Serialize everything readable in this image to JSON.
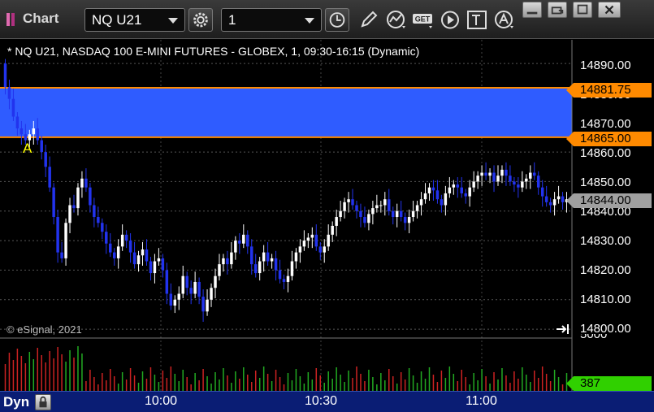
{
  "window": {
    "title": "Chart",
    "symbol": "NQ U21",
    "interval": "1",
    "get_label": "GET"
  },
  "chart": {
    "caption": "* NQ U21, NASDAQ 100 E-MINI FUTURES - GLOBEX, 1, 09:30-16:15 (Dynamic)",
    "copyright": "© eSignal, 2021",
    "marker": "A",
    "y_ticks": [
      "14890.00",
      "14880.00",
      "14870.00",
      "14860.00",
      "14850.00",
      "14840.00",
      "14830.00",
      "14820.00",
      "14810.00",
      "14800.00"
    ],
    "price_tags": {
      "upper": "14881.75",
      "lower": "14865.00",
      "last": "14844.00"
    },
    "volume_axis_label": "5000",
    "volume_last": "387",
    "colors": {
      "band": "#2f5cff",
      "band_edge": "#ff8a00",
      "candle": "#ffffff",
      "candle_down": "#2233ee",
      "volume_up": "#22aa22",
      "volume_down": "#cc2222"
    }
  },
  "bottom_bar": {
    "interval_label": "Dyn",
    "x_ticks": [
      "10:00",
      "10:30",
      "11:00"
    ]
  },
  "chart_data": {
    "type": "candlestick",
    "title": "* NQ U21, NASDAQ 100 E-MINI FUTURES - GLOBEX, 1, 09:30-16:15 (Dynamic)",
    "ylim": [
      14797,
      14898
    ],
    "x_ticks": [
      "10:00",
      "10:30",
      "11:00"
    ],
    "band": [
      14865.0,
      14881.75
    ],
    "last": 14844.0,
    "volume_last": 387,
    "close_path": [
      14882,
      14878,
      14872,
      14868,
      14866,
      14864,
      14866,
      14868,
      14864,
      14860,
      14855,
      14848,
      14838,
      14826,
      14824,
      14836,
      14842,
      14841,
      14848,
      14851,
      14848,
      14842,
      14838,
      14836,
      14833,
      14829,
      14826,
      14824,
      14828,
      14832,
      14830,
      14826,
      14822,
      14825,
      14827,
      14823,
      14819,
      14823,
      14824,
      14820,
      14812,
      14808,
      14810,
      14812,
      14818,
      14814,
      14812,
      14816,
      14811,
      14806,
      14810,
      14814,
      14818,
      14822,
      14824,
      14822,
      14826,
      14830,
      14829,
      14832,
      14828,
      14822,
      14819,
      14823,
      14826,
      14823,
      14824,
      14820,
      14817,
      14816,
      14818,
      14823,
      14826,
      14828,
      14830,
      14831,
      14832,
      14828,
      14826,
      14828,
      14832,
      14835,
      14838,
      14840,
      14843,
      14844,
      14842,
      14840,
      14838,
      14836,
      14839,
      14841,
      14842,
      14842,
      14844,
      14840,
      14838,
      14840,
      14838,
      14836,
      14838,
      14840,
      14842,
      14844,
      14846,
      14848,
      14847,
      14844,
      14842,
      14846,
      14848,
      14849,
      14848,
      14846,
      14845,
      14848,
      14850,
      14852,
      14853,
      14852,
      14853,
      14850,
      14852,
      14854,
      14852,
      14850,
      14849,
      14848,
      14850,
      14851,
      14853,
      14852,
      14848,
      14845,
      14843,
      14842,
      14844,
      14845,
      14843,
      14844
    ]
  }
}
